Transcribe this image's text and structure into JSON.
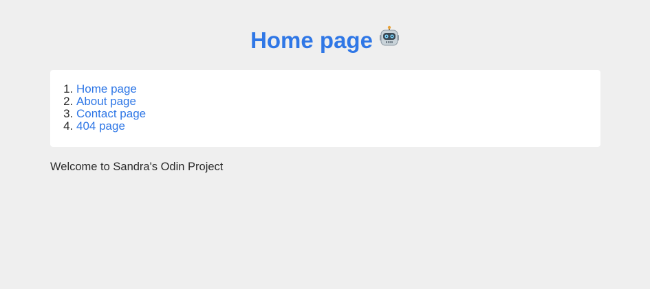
{
  "header": {
    "title": "Home page",
    "emoji_icon": "robot-icon"
  },
  "nav": {
    "items": [
      {
        "label": "Home page"
      },
      {
        "label": "About page"
      },
      {
        "label": "Contact page"
      },
      {
        "label": "404 page"
      }
    ]
  },
  "main": {
    "welcome_text": "Welcome to Sandra's Odin Project"
  },
  "colors": {
    "background": "#efefef",
    "accent": "#2f77e6",
    "card": "#ffffff",
    "text": "#2b2b2b"
  }
}
